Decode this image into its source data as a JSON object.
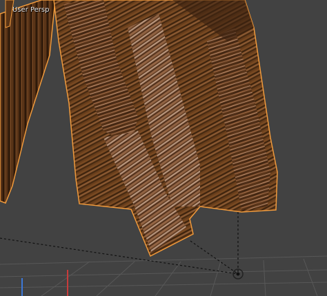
{
  "viewport": {
    "title": "User Persp",
    "background_color": "#3f3f3f",
    "selection_outline_color": "#f09a3c"
  },
  "scene": {
    "object": "textured-mesh-selected",
    "pivot_icon": "3d-cursor-icon",
    "axis_colors": {
      "x": "#c83b3b",
      "y": "#6fba38",
      "z": "#3c78d8"
    }
  }
}
